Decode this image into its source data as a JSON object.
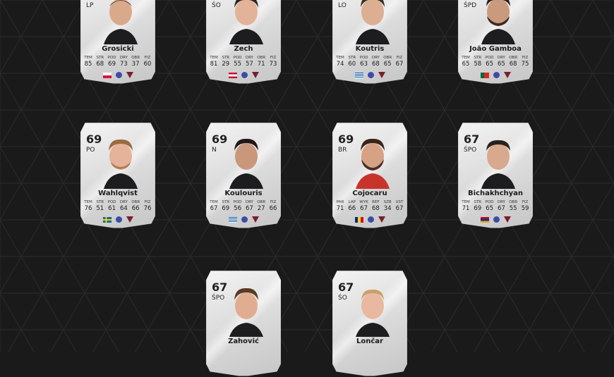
{
  "background": {
    "color": "#1a1a1a",
    "line_color": "#2e2e2e"
  },
  "cards": [
    {
      "id": "grosicki",
      "rating": "",
      "position": "LP",
      "name": "Grosicki",
      "stat_labels": [
        "TEM",
        "STR",
        "POD",
        "DRY",
        "OBR",
        "FIZ"
      ],
      "stat_values": [
        "85",
        "68",
        "69",
        "73",
        "37",
        "60"
      ],
      "flag": "poland"
    },
    {
      "id": "zech",
      "rating": "",
      "position": "ŚO",
      "name": "Zech",
      "stat_labels": [
        "TEM",
        "STR",
        "POD",
        "DRY",
        "OBR",
        "FIZ"
      ],
      "stat_values": [
        "81",
        "29",
        "55",
        "57",
        "71",
        "73"
      ],
      "flag": "austria"
    },
    {
      "id": "koutris",
      "rating": "",
      "position": "LO",
      "name": "Koutris",
      "stat_labels": [
        "TEM",
        "STR",
        "POD",
        "DRY",
        "OBR",
        "FIZ"
      ],
      "stat_values": [
        "74",
        "60",
        "63",
        "68",
        "65",
        "67"
      ],
      "flag": "greece"
    },
    {
      "id": "gamboa",
      "rating": "",
      "position": "ŚPD",
      "name": "João Gamboa",
      "stat_labels": [
        "TEM",
        "STR",
        "POD",
        "DRY",
        "OBR",
        "FIZ"
      ],
      "stat_values": [
        "65",
        "58",
        "65",
        "65",
        "68",
        "75"
      ],
      "flag": "portugal"
    },
    {
      "id": "wahlqvist",
      "rating": "69",
      "position": "PO",
      "name": "Wahlqvist",
      "stat_labels": [
        "TEM",
        "STR",
        "POD",
        "DRY",
        "OBR",
        "FIZ"
      ],
      "stat_values": [
        "76",
        "51",
        "61",
        "64",
        "66",
        "76"
      ],
      "flag": "sweden"
    },
    {
      "id": "koulouris",
      "rating": "69",
      "position": "N",
      "name": "Koulouris",
      "stat_labels": [
        "TEM",
        "STR",
        "POD",
        "DRY",
        "OBR",
        "FIZ"
      ],
      "stat_values": [
        "67",
        "69",
        "56",
        "67",
        "27",
        "66"
      ],
      "flag": "greece"
    },
    {
      "id": "cojocaru",
      "rating": "69",
      "position": "BR",
      "name": "Cojocaru",
      "stat_labels": [
        "PAR",
        "LAP",
        "WYK",
        "REF",
        "SZB",
        "UST"
      ],
      "stat_values": [
        "71",
        "66",
        "67",
        "68",
        "34",
        "67"
      ],
      "flag": "romania"
    },
    {
      "id": "bichakhchyan",
      "rating": "67",
      "position": "ŚPO",
      "name": "Bichakhchyan",
      "stat_labels": [
        "TEM",
        "STR",
        "POD",
        "DRY",
        "OBR",
        "FIZ"
      ],
      "stat_values": [
        "71",
        "69",
        "65",
        "67",
        "55",
        "59"
      ],
      "flag": "armenia"
    },
    {
      "id": "zahovic",
      "rating": "67",
      "position": "ŚPO",
      "name": "Zahović",
      "stat_labels": [],
      "stat_values": [],
      "flag": ""
    },
    {
      "id": "loncar",
      "rating": "67",
      "position": "ŚO",
      "name": "Lončar",
      "stat_labels": [],
      "stat_values": [],
      "flag": ""
    }
  ],
  "icons": {
    "league": "league-badge-icon",
    "club": "club-crest-icon"
  }
}
